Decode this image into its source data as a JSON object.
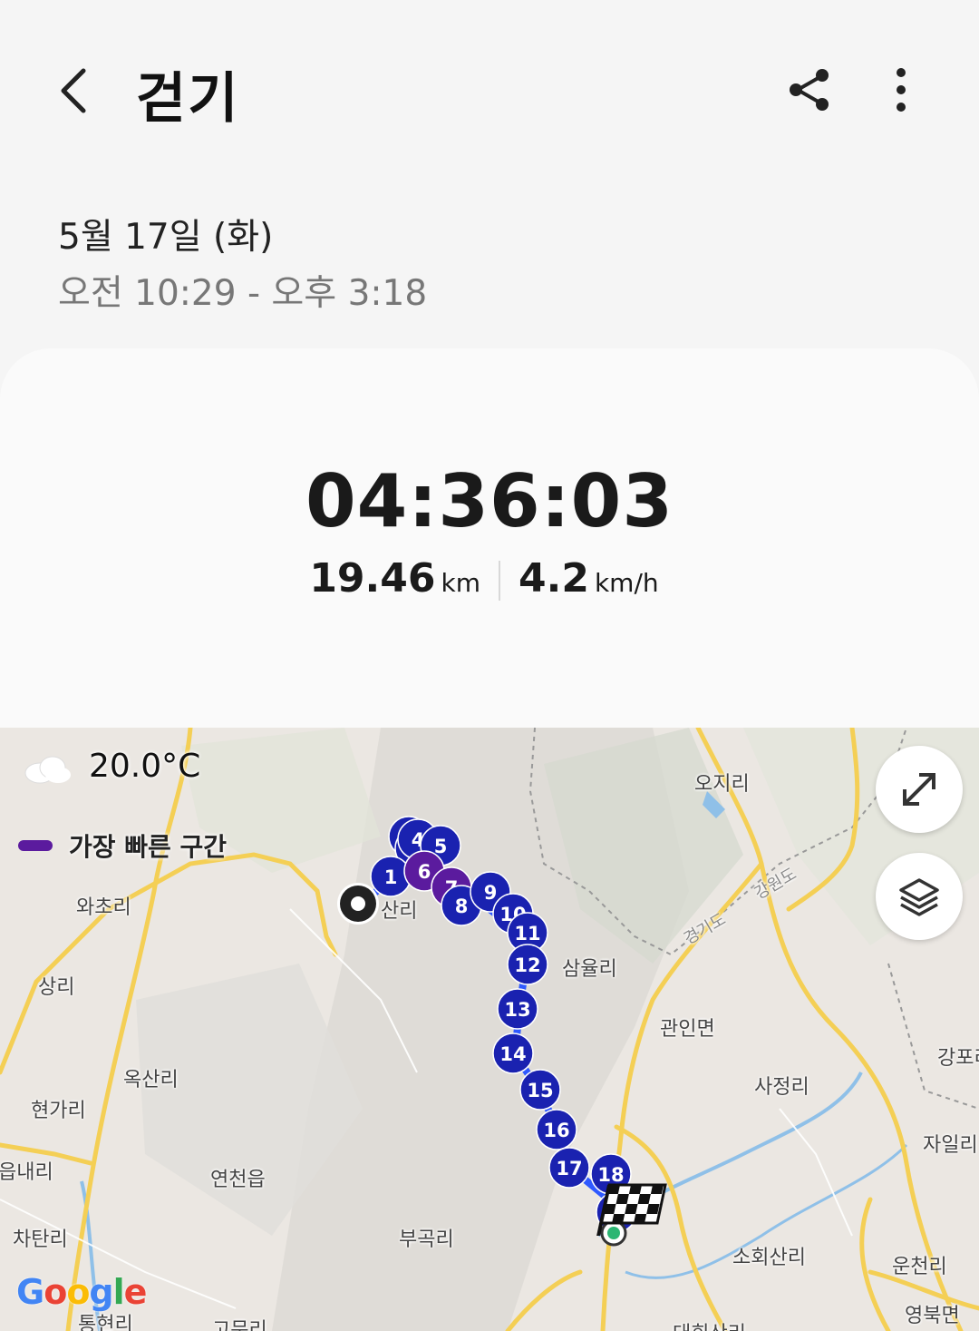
{
  "header": {
    "title": "걷기",
    "back_icon": "chevron-left-icon",
    "share_icon": "share-icon",
    "more_icon": "more-vertical-icon"
  },
  "session": {
    "date": "5월 17일 (화)",
    "time_range": "오전 10:29 - 오후 3:18"
  },
  "summary": {
    "duration": "04:36:03",
    "distance_value": "19.46",
    "distance_unit": "km",
    "speed_value": "4.2",
    "speed_unit": "km/h"
  },
  "map": {
    "weather_icon": "cloud-icon",
    "temperature": "20.0°C",
    "legend_label": "가장 빠른 구간",
    "legend_color": "#5b1b9e",
    "route_color": "#1a33c7",
    "marker_color": "#1a22b0",
    "fast_marker_color": "#5b1b9e",
    "start_icon": "start-point-icon",
    "finish_icon": "checkered-flag-icon",
    "expand_icon": "expand-icon",
    "layers_icon": "layers-icon",
    "attribution": "Google",
    "split_markers": [
      {
        "label": "1",
        "fastest": false
      },
      {
        "label": "2",
        "fastest": false
      },
      {
        "label": "3",
        "fastest": false
      },
      {
        "label": "4",
        "fastest": false
      },
      {
        "label": "5",
        "fastest": false
      },
      {
        "label": "6",
        "fastest": true
      },
      {
        "label": "7",
        "fastest": true
      },
      {
        "label": "8",
        "fastest": false
      },
      {
        "label": "9",
        "fastest": false
      },
      {
        "label": "10",
        "fastest": false
      },
      {
        "label": "11",
        "fastest": false
      },
      {
        "label": "12",
        "fastest": false
      },
      {
        "label": "13",
        "fastest": false
      },
      {
        "label": "14",
        "fastest": false
      },
      {
        "label": "15",
        "fastest": false
      },
      {
        "label": "16",
        "fastest": false
      },
      {
        "label": "17",
        "fastest": false
      },
      {
        "label": "18",
        "fastest": false
      },
      {
        "label": "19",
        "fastest": false
      }
    ],
    "place_labels": {
      "ojiri": "오지리",
      "wachori": "와초리",
      "sanri_partial": "산리",
      "samyulri": "삼율리",
      "sangri": "상리",
      "gwaninmyeon": "관인면",
      "gangpo": "강포리",
      "oksanri": "옥산리",
      "hyeongari": "현가리",
      "sajeongri": "사정리",
      "eumnaeri": "읍내리",
      "yeoncheoneup": "연천읍",
      "jailri": "자일리",
      "chatanri": "차탄리",
      "bugokri": "부곡리",
      "sohoesanri": "소회산리",
      "uncheonri": "운천리",
      "tongyeonri": "통현리",
      "gomunri": "고문리",
      "yeongbukmyeon": "영북면",
      "daehoesanri": "대회산리",
      "gyeonggido": "경기도",
      "gangwondo": "강원도"
    }
  }
}
